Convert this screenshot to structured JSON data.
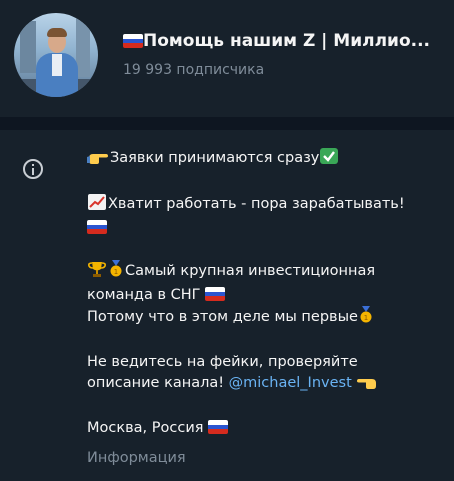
{
  "channel": {
    "title_flag": "flag-russia-icon",
    "title": "Помощь нашим Z | Миллио...",
    "subscribers": "19 993 подписчика"
  },
  "description": {
    "line1": "Заявки принимаются сразу",
    "line2": "Хватит работать - пора зарабатывать!",
    "line3a": "Самый крупная инвестиционная",
    "line3b": "команда в СНГ",
    "line4": "Потому что в этом деле мы первые",
    "line5": "Не ведитесь на фейки, проверяйте",
    "line6_prefix": "описание канала!",
    "link": "@michael_Invest",
    "line7": "Москва, Россия"
  },
  "info_label": "Информация",
  "colors": {
    "background": "#17212b",
    "divider": "#0e1621",
    "link": "#6ab3f3",
    "muted": "#7f8c99"
  }
}
